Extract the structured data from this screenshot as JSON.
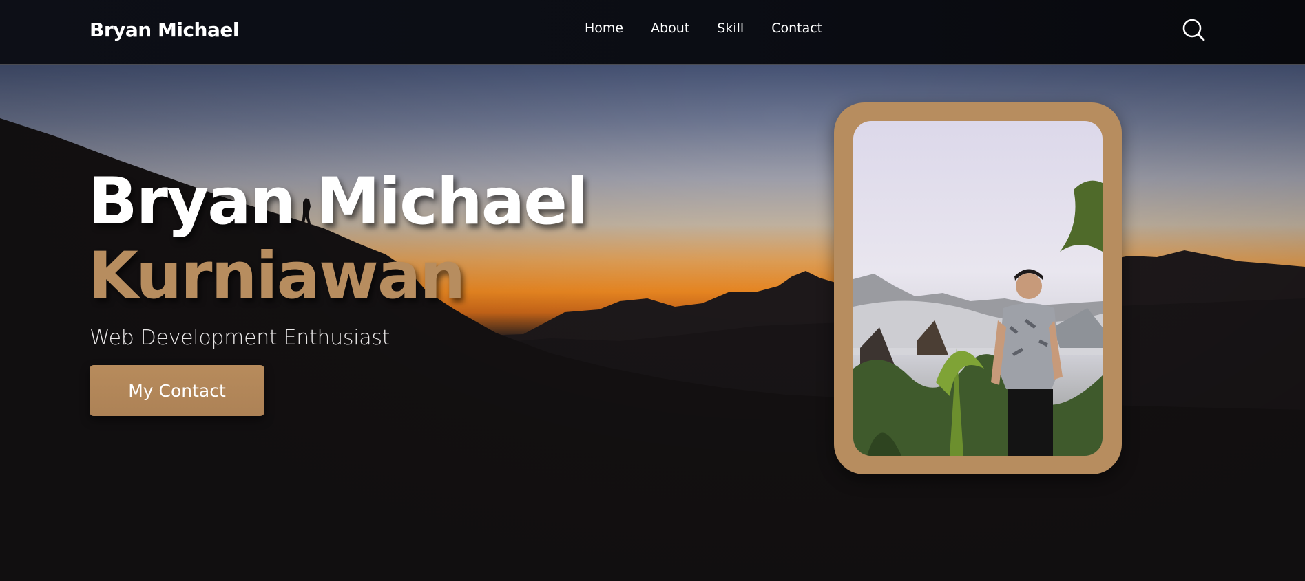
{
  "navbar": {
    "brand": "Bryan Michael",
    "links": [
      "Home",
      "About",
      "Skill",
      "Contact"
    ],
    "search_icon": "search-icon"
  },
  "hero": {
    "first_name": "Bryan Michael",
    "last_name": "Kurniawan",
    "subtitle": "Web Development Enthusiast",
    "cta_label": "My Contact"
  },
  "colors": {
    "accent": "#b78d5f",
    "navbar_bg": "#0b0d14",
    "text": "#ffffff",
    "sunset_orange": "#f68e23"
  }
}
